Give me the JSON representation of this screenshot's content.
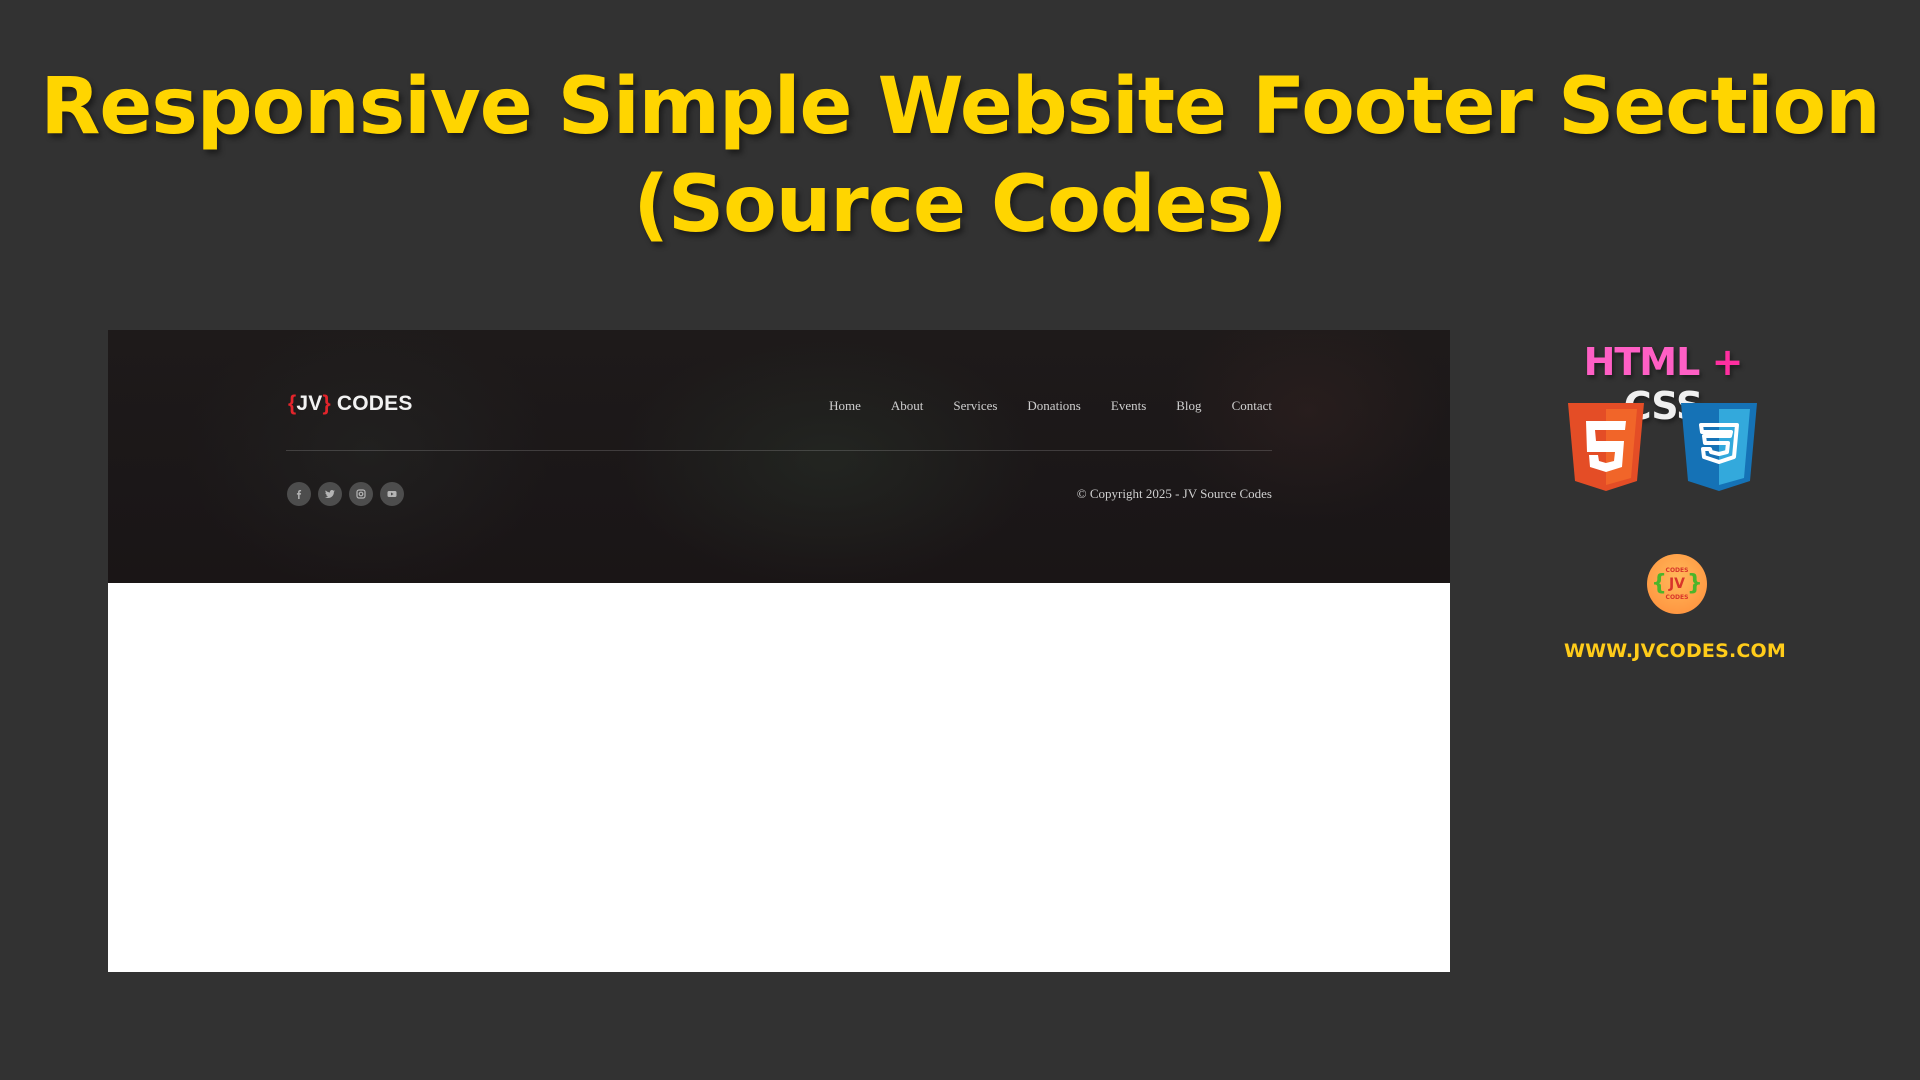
{
  "headline": {
    "line1": "Responsive Simple Website Footer Section",
    "line2": "(Source Codes)"
  },
  "preview": {
    "logo": {
      "open_brace": "{",
      "initials": "JV",
      "close_brace": "}",
      "word": " CODES"
    },
    "nav": [
      {
        "label": "Home"
      },
      {
        "label": "About"
      },
      {
        "label": "Services"
      },
      {
        "label": "Donations"
      },
      {
        "label": "Events"
      },
      {
        "label": "Blog"
      },
      {
        "label": "Contact"
      }
    ],
    "socials": [
      {
        "icon": "facebook-icon"
      },
      {
        "icon": "twitter-icon"
      },
      {
        "icon": "instagram-icon"
      },
      {
        "icon": "youtube-icon"
      }
    ],
    "copyright": "© Copyright 2025 - JV Source Codes"
  },
  "sidebar": {
    "tech_html": "HTML",
    "tech_plus": "+",
    "tech_css": "CSS",
    "html5_icon": "html5-shield-icon",
    "css3_icon": "css3-shield-icon",
    "badge": {
      "top": "CODES",
      "left_brace": "{",
      "initials": "JV",
      "right_brace": "}",
      "bottom": "CODES"
    },
    "url": "WWW.JVCODES.COM"
  },
  "colors": {
    "headline": "#ffd500",
    "background": "#323232",
    "brace_red": "#e3242b",
    "html_pink": "#ff5fc5",
    "url_yellow": "#ffcc1a"
  }
}
